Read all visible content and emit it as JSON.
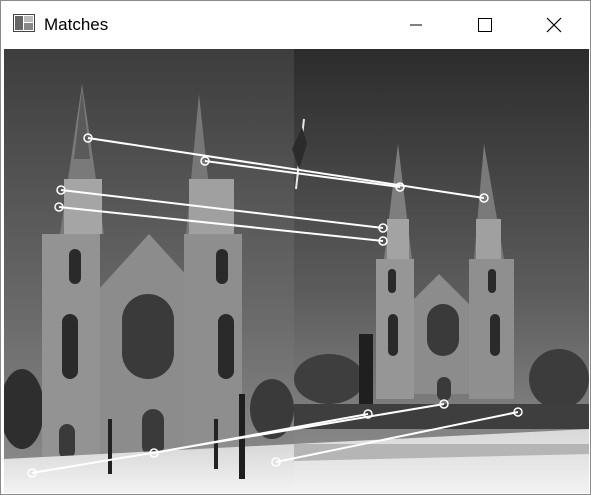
{
  "window": {
    "title": "Matches",
    "app_icon": "opencv-window-icon",
    "controls": {
      "minimize_icon": "minimize-icon",
      "maximize_icon": "maximize-icon",
      "close_icon": "close-icon"
    }
  },
  "image": {
    "description_icon": "church-image-pair",
    "palette": {
      "sky_light": "#8a8a8a",
      "sky_dark": "#3a3a3a",
      "building": "#9b9b9b",
      "snow": "#e6e6e6",
      "match_line": "#ffffff"
    },
    "match_count": 7
  }
}
